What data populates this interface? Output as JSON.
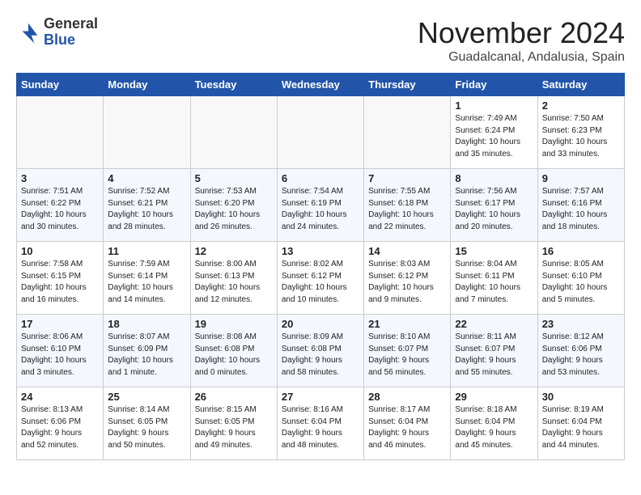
{
  "header": {
    "logo_general": "General",
    "logo_blue": "Blue",
    "month_title": "November 2024",
    "location": "Guadalcanal, Andalusia, Spain"
  },
  "weekdays": [
    "Sunday",
    "Monday",
    "Tuesday",
    "Wednesday",
    "Thursday",
    "Friday",
    "Saturday"
  ],
  "weeks": [
    [
      {
        "day": "",
        "info": ""
      },
      {
        "day": "",
        "info": ""
      },
      {
        "day": "",
        "info": ""
      },
      {
        "day": "",
        "info": ""
      },
      {
        "day": "",
        "info": ""
      },
      {
        "day": "1",
        "info": "Sunrise: 7:49 AM\nSunset: 6:24 PM\nDaylight: 10 hours\nand 35 minutes."
      },
      {
        "day": "2",
        "info": "Sunrise: 7:50 AM\nSunset: 6:23 PM\nDaylight: 10 hours\nand 33 minutes."
      }
    ],
    [
      {
        "day": "3",
        "info": "Sunrise: 7:51 AM\nSunset: 6:22 PM\nDaylight: 10 hours\nand 30 minutes."
      },
      {
        "day": "4",
        "info": "Sunrise: 7:52 AM\nSunset: 6:21 PM\nDaylight: 10 hours\nand 28 minutes."
      },
      {
        "day": "5",
        "info": "Sunrise: 7:53 AM\nSunset: 6:20 PM\nDaylight: 10 hours\nand 26 minutes."
      },
      {
        "day": "6",
        "info": "Sunrise: 7:54 AM\nSunset: 6:19 PM\nDaylight: 10 hours\nand 24 minutes."
      },
      {
        "day": "7",
        "info": "Sunrise: 7:55 AM\nSunset: 6:18 PM\nDaylight: 10 hours\nand 22 minutes."
      },
      {
        "day": "8",
        "info": "Sunrise: 7:56 AM\nSunset: 6:17 PM\nDaylight: 10 hours\nand 20 minutes."
      },
      {
        "day": "9",
        "info": "Sunrise: 7:57 AM\nSunset: 6:16 PM\nDaylight: 10 hours\nand 18 minutes."
      }
    ],
    [
      {
        "day": "10",
        "info": "Sunrise: 7:58 AM\nSunset: 6:15 PM\nDaylight: 10 hours\nand 16 minutes."
      },
      {
        "day": "11",
        "info": "Sunrise: 7:59 AM\nSunset: 6:14 PM\nDaylight: 10 hours\nand 14 minutes."
      },
      {
        "day": "12",
        "info": "Sunrise: 8:00 AM\nSunset: 6:13 PM\nDaylight: 10 hours\nand 12 minutes."
      },
      {
        "day": "13",
        "info": "Sunrise: 8:02 AM\nSunset: 6:12 PM\nDaylight: 10 hours\nand 10 minutes."
      },
      {
        "day": "14",
        "info": "Sunrise: 8:03 AM\nSunset: 6:12 PM\nDaylight: 10 hours\nand 9 minutes."
      },
      {
        "day": "15",
        "info": "Sunrise: 8:04 AM\nSunset: 6:11 PM\nDaylight: 10 hours\nand 7 minutes."
      },
      {
        "day": "16",
        "info": "Sunrise: 8:05 AM\nSunset: 6:10 PM\nDaylight: 10 hours\nand 5 minutes."
      }
    ],
    [
      {
        "day": "17",
        "info": "Sunrise: 8:06 AM\nSunset: 6:10 PM\nDaylight: 10 hours\nand 3 minutes."
      },
      {
        "day": "18",
        "info": "Sunrise: 8:07 AM\nSunset: 6:09 PM\nDaylight: 10 hours\nand 1 minute."
      },
      {
        "day": "19",
        "info": "Sunrise: 8:08 AM\nSunset: 6:08 PM\nDaylight: 10 hours\nand 0 minutes."
      },
      {
        "day": "20",
        "info": "Sunrise: 8:09 AM\nSunset: 6:08 PM\nDaylight: 9 hours\nand 58 minutes."
      },
      {
        "day": "21",
        "info": "Sunrise: 8:10 AM\nSunset: 6:07 PM\nDaylight: 9 hours\nand 56 minutes."
      },
      {
        "day": "22",
        "info": "Sunrise: 8:11 AM\nSunset: 6:07 PM\nDaylight: 9 hours\nand 55 minutes."
      },
      {
        "day": "23",
        "info": "Sunrise: 8:12 AM\nSunset: 6:06 PM\nDaylight: 9 hours\nand 53 minutes."
      }
    ],
    [
      {
        "day": "24",
        "info": "Sunrise: 8:13 AM\nSunset: 6:06 PM\nDaylight: 9 hours\nand 52 minutes."
      },
      {
        "day": "25",
        "info": "Sunrise: 8:14 AM\nSunset: 6:05 PM\nDaylight: 9 hours\nand 50 minutes."
      },
      {
        "day": "26",
        "info": "Sunrise: 8:15 AM\nSunset: 6:05 PM\nDaylight: 9 hours\nand 49 minutes."
      },
      {
        "day": "27",
        "info": "Sunrise: 8:16 AM\nSunset: 6:04 PM\nDaylight: 9 hours\nand 48 minutes."
      },
      {
        "day": "28",
        "info": "Sunrise: 8:17 AM\nSunset: 6:04 PM\nDaylight: 9 hours\nand 46 minutes."
      },
      {
        "day": "29",
        "info": "Sunrise: 8:18 AM\nSunset: 6:04 PM\nDaylight: 9 hours\nand 45 minutes."
      },
      {
        "day": "30",
        "info": "Sunrise: 8:19 AM\nSunset: 6:04 PM\nDaylight: 9 hours\nand 44 minutes."
      }
    ]
  ]
}
